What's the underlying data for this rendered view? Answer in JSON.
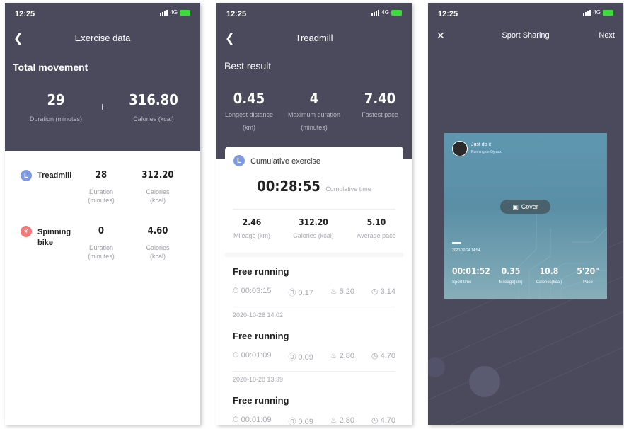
{
  "status": {
    "time": "12:25",
    "network": "4G"
  },
  "screen1": {
    "title": "Exercise data",
    "section": "Total movement",
    "total": {
      "duration_value": "29",
      "duration_label": "Duration (minutes)",
      "calories_value": "316.80",
      "calories_label": "Calories (kcal)"
    },
    "items": [
      {
        "name": "Treadmill",
        "duration": "28",
        "duration_label": "Duration\n(minutes)",
        "calories": "312.20",
        "calories_label": "Calories\n(kcal)",
        "color": "#7f9ae0"
      },
      {
        "name": "Spinning bike",
        "duration": "0",
        "duration_label": "Duration\n(minutes)",
        "calories": "4.60",
        "calories_label": "Calories\n(kcal)",
        "color": "#f07b7b"
      }
    ]
  },
  "screen2": {
    "title": "Treadmill",
    "section": "Best result",
    "best": [
      {
        "value": "0.45",
        "label": "Longest distance (km)"
      },
      {
        "value": "4",
        "label": "Maximum duration (minutes)"
      },
      {
        "value": "7.40",
        "label": "Fastest pace"
      }
    ],
    "cumulative": {
      "title": "Cumulative exercise",
      "time": "00:28:55",
      "time_label": "Cumulative time",
      "stats": [
        {
          "value": "2.46",
          "label": "Mileage (km)"
        },
        {
          "value": "312.20",
          "label": "Calories (kcal)"
        },
        {
          "value": "5.10",
          "label": "Average pace"
        }
      ]
    },
    "runs": [
      {
        "title": "Free running",
        "time": "00:03:15",
        "distance": "0.17",
        "calories": "5.20",
        "pace": "3.14",
        "date": "2020-10-28 14:02"
      },
      {
        "title": "Free running",
        "time": "00:01:09",
        "distance": "0.09",
        "calories": "2.80",
        "pace": "4.70",
        "date": "2020-10-28 13:39"
      },
      {
        "title": "Free running",
        "time": "00:01:09",
        "distance": "0.09",
        "calories": "2.80",
        "pace": "4.70",
        "date": ""
      }
    ]
  },
  "screen3": {
    "title": "Sport Sharing",
    "next": "Next",
    "card": {
      "slogan": "Just do it",
      "subtitle": "Running on Gymax",
      "cover": "Cover",
      "date": "2020-10-24 14:54",
      "stats": [
        {
          "value": "00:01:52",
          "label": "Sport time"
        },
        {
          "value": "0.35",
          "label": "Mileage(km)"
        },
        {
          "value": "10.8",
          "label": "Calories(kcal)"
        },
        {
          "value": "5'20\"",
          "label": "Pace"
        }
      ]
    }
  }
}
